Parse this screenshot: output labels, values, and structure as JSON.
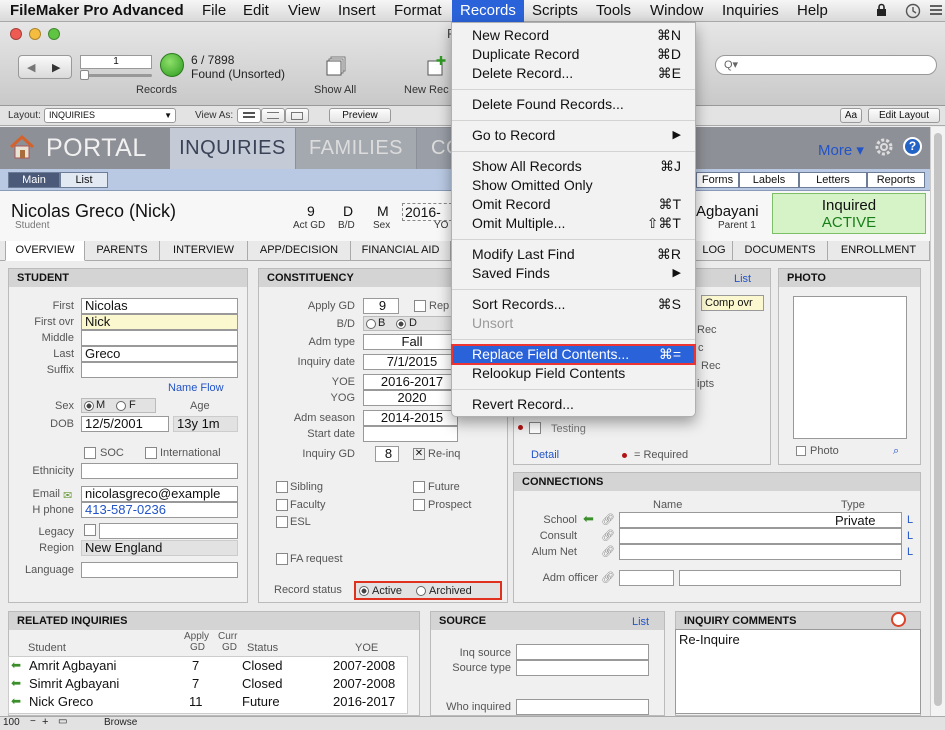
{
  "menubar": {
    "app": "FileMaker Pro Advanced",
    "items": [
      "File",
      "Edit",
      "View",
      "Insert",
      "Format",
      "Records",
      "Scripts",
      "Tools",
      "Window",
      "Inquiries",
      "Help"
    ]
  },
  "toolbar": {
    "record_number": "1",
    "found_count": "6 / 7898",
    "found_status": "Found (Unsorted)",
    "records_label": "Records",
    "show_all_label": "Show All",
    "new_record_label": "New Rec",
    "title_fragment": "F",
    "search_placeholder": "Q▾"
  },
  "layoutbar": {
    "layout_label": "Layout:",
    "layout_value": "INQUIRIES",
    "view_as_label": "View As:",
    "preview_label": "Preview",
    "aa_label": "Aa",
    "edit_layout_label": "Edit Layout"
  },
  "topnav": {
    "portal": "PORTAL",
    "tabs": [
      "INQUIRIES",
      "FAMILIES",
      "CO"
    ],
    "more": "More"
  },
  "subnav": {
    "main": "Main",
    "list": "List",
    "right": [
      "Forms",
      "Labels",
      "Letters",
      "Reports"
    ]
  },
  "header": {
    "name": "Nicolas Greco (Nick)",
    "role": "Student",
    "act_gd_value": "9",
    "act_gd_label": "Act GD",
    "bd_value": "D",
    "bd_label": "B/D",
    "sex_value": "M",
    "sex_label": "Sex",
    "yoe_value": "2016-",
    "yoe_label": "YO",
    "parent_name": "Agbayani",
    "parent_label": "Parent 1",
    "status_line1": "Inquired",
    "status_line2": "ACTIVE"
  },
  "tabs": [
    "OVERVIEW",
    "PARENTS",
    "INTERVIEW",
    "APP/DECISION",
    "FINANCIAL AID",
    "LOG",
    "DOCUMENTS",
    "ENROLLMENT"
  ],
  "student": {
    "title": "STUDENT",
    "first_label": "First",
    "first": "Nicolas",
    "firstovr_label": "First ovr",
    "firstovr": "Nick",
    "middle_label": "Middle",
    "middle": "",
    "last_label": "Last",
    "last": "Greco",
    "suffix_label": "Suffix",
    "suffix": "",
    "name_flow": "Name Flow",
    "sex_label": "Sex",
    "sex_m": "M",
    "sex_f": "F",
    "age_label": "Age",
    "dob_label": "DOB",
    "dob": "12/5/2001",
    "age": "13y 1m",
    "soc": "SOC",
    "international": "International",
    "ethnicity_label": "Ethnicity",
    "email_label": "Email",
    "email": "nicolasgreco@example",
    "hphone_label": "H phone",
    "hphone": "413-587-0236",
    "legacy_label": "Legacy",
    "region_label": "Region",
    "region": "New England",
    "language_label": "Language"
  },
  "constituency": {
    "title": "CONSTITUENCY",
    "apply_gd_label": "Apply GD",
    "apply_gd": "9",
    "rep": "Rep",
    "bd_label": "B/D",
    "b": "B",
    "d": "D",
    "adm_type_label": "Adm type",
    "adm_type": "Fall",
    "inquiry_date_label": "Inquiry date",
    "inquiry_date": "7/1/2015",
    "yoe_label": "YOE",
    "yoe": "2016-2017",
    "yog_label": "YOG",
    "yog": "2020",
    "adm_season_label": "Adm season",
    "adm_season": "2014-2015",
    "start_date_label": "Start date",
    "inquiry_gd_label": "Inquiry GD",
    "inquiry_gd": "8",
    "reinq": "Re-inq",
    "sibling": "Sibling",
    "future": "Future",
    "faculty": "Faculty",
    "prospect": "Prospect",
    "esl": "ESL",
    "fa_request": "FA request",
    "record_status_label": "Record status",
    "active": "Active",
    "archived": "Archived"
  },
  "middle_panel": {
    "list": "List",
    "comp_ovr": "Comp ovr",
    "rec1": "Rec",
    "c": "c",
    "rec2": "Rec",
    "ipts": "ipts",
    "testing": "Testing",
    "detail": "Detail",
    "required": "= Required"
  },
  "photo": {
    "title": "PHOTO",
    "label": "Photo"
  },
  "connections": {
    "title": "CONNECTIONS",
    "name_col": "Name",
    "type_col": "Type",
    "school_label": "School",
    "school_type": "Private",
    "consult_label": "Consult",
    "alumnet_label": "Alum Net",
    "admofficer_label": "Adm officer",
    "l": "L"
  },
  "related": {
    "title": "RELATED INQUIRIES",
    "cols": {
      "student": "Student",
      "apply": "Apply",
      "gd": "GD",
      "curr": "Curr",
      "gd2": "GD",
      "status": "Status",
      "yoe": "YOE"
    },
    "rows": [
      {
        "student": "Amrit Agbayani",
        "gd": "7",
        "status": "Closed",
        "yoe": "2007-2008"
      },
      {
        "student": "Simrit Agbayani",
        "gd": "7",
        "status": "Closed",
        "yoe": "2007-2008"
      },
      {
        "student": "Nick Greco",
        "gd": "11",
        "status": "Future",
        "yoe": "2016-2017"
      }
    ]
  },
  "source": {
    "title": "SOURCE",
    "list": "List",
    "inq_source_label": "Inq source",
    "source_type_label": "Source type",
    "who_inquired_label": "Who inquired"
  },
  "comments": {
    "title": "INQUIRY COMMENTS",
    "text": "Re-Inquire"
  },
  "statusbar": {
    "zoom": "100",
    "mode": "Browse"
  },
  "records_menu": {
    "items": [
      {
        "label": "New Record",
        "shortcut": "⌘N"
      },
      {
        "label": "Duplicate Record",
        "shortcut": "⌘D"
      },
      {
        "label": "Delete Record...",
        "shortcut": "⌘E"
      },
      {
        "label": "Delete Found Records...",
        "shortcut": ""
      },
      {
        "label": "Go to Record",
        "shortcut": "▶"
      },
      {
        "label": "Show All Records",
        "shortcut": "⌘J"
      },
      {
        "label": "Show Omitted Only",
        "shortcut": ""
      },
      {
        "label": "Omit Record",
        "shortcut": "⌘T"
      },
      {
        "label": "Omit Multiple...",
        "shortcut": "⇧⌘T"
      },
      {
        "label": "Modify Last Find",
        "shortcut": "⌘R"
      },
      {
        "label": "Saved Finds",
        "shortcut": "▶"
      },
      {
        "label": "Sort Records...",
        "shortcut": "⌘S"
      },
      {
        "label": "Unsort",
        "shortcut": ""
      },
      {
        "label": "Replace Field Contents...",
        "shortcut": "⌘="
      },
      {
        "label": "Relookup Field Contents",
        "shortcut": ""
      },
      {
        "label": "Revert Record...",
        "shortcut": ""
      }
    ]
  }
}
